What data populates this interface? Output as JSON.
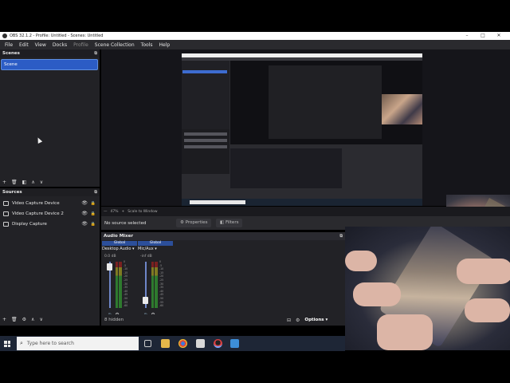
{
  "window": {
    "title": "OBS 32.1.2 - Profile: Untitled - Scenes: Untitled",
    "controls": [
      "–",
      "□",
      "✕"
    ]
  },
  "menu": [
    "File",
    "Edit",
    "View",
    "Docks",
    "Profile",
    "Scene Collection",
    "Tools",
    "Help"
  ],
  "scenes": {
    "title": "Scenes",
    "items": [
      "Scene"
    ]
  },
  "sources": {
    "title": "Sources",
    "items": [
      {
        "label": "Video Capture Device",
        "icon": "camera-icon"
      },
      {
        "label": "Video Capture Device 2",
        "icon": "camera-icon"
      },
      {
        "label": "Display Capture",
        "icon": "monitor-icon"
      }
    ]
  },
  "preview_controls": {
    "zoom": "47%",
    "scale": "Scale to Window"
  },
  "source_toolbar": {
    "no_source": "No source selected",
    "properties": "Properties",
    "filters": "Filters"
  },
  "audio_mixer": {
    "title": "Audio Mixer",
    "channels": [
      {
        "bind": "Global",
        "name": "Desktop Audio",
        "db": "0.0 dB",
        "level": 0.95
      },
      {
        "bind": "Global",
        "name": "Mic/Aux",
        "db": "-inf dB",
        "level": 0.1
      }
    ],
    "ticks": [
      "0",
      "-5",
      "-10",
      "-15",
      "-20",
      "-25",
      "-30",
      "-35",
      "-40",
      "-45",
      "-50",
      "-55",
      "-60"
    ],
    "hidden": "8 hidden"
  },
  "controls": {
    "options": "Options"
  },
  "taskbar": {
    "search_placeholder": "Type here to search"
  },
  "colors": {
    "accent": "#2c5cc5",
    "panel": "#222226",
    "taskbar": "#1e2636"
  }
}
